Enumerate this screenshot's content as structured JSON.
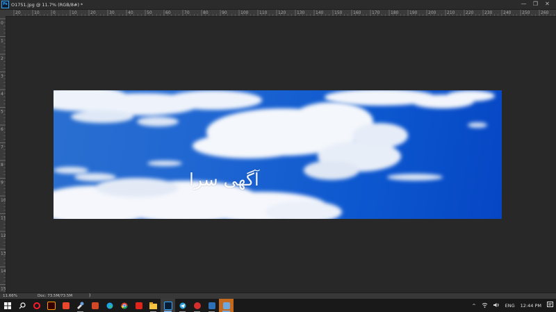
{
  "window": {
    "app_badge": "Ps",
    "title": "O1751.jpg @ 11.7% (RGB/8#) *",
    "controls": [
      "—",
      "❐",
      "✕"
    ]
  },
  "ruler": {
    "top_labels": [
      "20",
      "10",
      "0",
      "10",
      "20",
      "30",
      "40",
      "50",
      "60",
      "70",
      "80",
      "90",
      "100",
      "110",
      "120",
      "130",
      "140",
      "150",
      "160",
      "170",
      "180",
      "190",
      "200",
      "210",
      "220",
      "230",
      "240",
      "250",
      "260"
    ],
    "left_labels": [
      "0",
      "1",
      "2",
      "3",
      "4",
      "5",
      "6",
      "7",
      "8",
      "9",
      "10",
      "11",
      "12",
      "13",
      "14",
      "15"
    ]
  },
  "document": {
    "watermark_text": "آگهی سرا"
  },
  "status": {
    "zoom": "11.66%",
    "doc_info": "Doc: 73.5M/73.5M",
    "arrow": ")"
  },
  "taskbar": {
    "apps": [
      {
        "name": "start",
        "color": "#ffffff"
      },
      {
        "name": "search",
        "color": "#ffffff"
      },
      {
        "name": "opera",
        "color": "#ff1b2d"
      },
      {
        "name": "illustrator",
        "color": "#ff9a00"
      },
      {
        "name": "smartsheet",
        "color": "#e8472d"
      },
      {
        "name": "tools",
        "color": "#ffffff"
      },
      {
        "name": "powerpoint",
        "color": "#d24726"
      },
      {
        "name": "edge",
        "color": "#1fa0e8"
      },
      {
        "name": "chrome",
        "color": "#fbbc05"
      },
      {
        "name": "acrobat",
        "color": "#e2241b"
      },
      {
        "name": "file-explorer",
        "color": "#f5c342"
      },
      {
        "name": "photoshop",
        "color": "#31a8ff"
      },
      {
        "name": "telegram",
        "color": "#2aa1da"
      },
      {
        "name": "wps",
        "color": "#d32f2f"
      },
      {
        "name": "smartsheet2",
        "color": "#e8472d"
      },
      {
        "name": "photos",
        "color": "#e08a2e"
      }
    ],
    "tray": {
      "chevron": "^",
      "language": "ENG",
      "time": "12:44 PM"
    }
  }
}
